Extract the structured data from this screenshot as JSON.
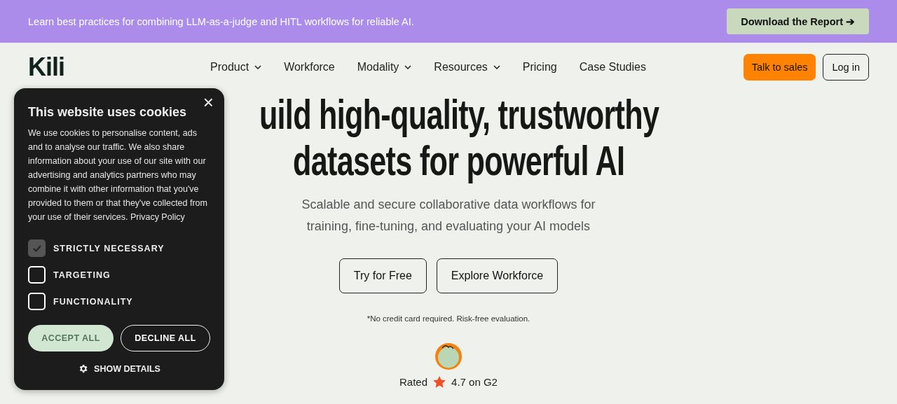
{
  "banner": {
    "text": "Learn best practices for combining LLM-as-a-judge and HITL workflows for reliable AI.",
    "button": "Download the Report ➔"
  },
  "header": {
    "logo": "Kili",
    "nav": [
      {
        "label": "Product",
        "dropdown": true
      },
      {
        "label": "Workforce",
        "dropdown": false
      },
      {
        "label": "Modality",
        "dropdown": true
      },
      {
        "label": "Resources",
        "dropdown": true
      },
      {
        "label": "Pricing",
        "dropdown": false
      },
      {
        "label": "Case Studies",
        "dropdown": false
      }
    ],
    "talk_button": "Talk to sales",
    "login_button": "Log in"
  },
  "hero": {
    "title_lines": [
      "uild high-quality, trustworthy",
      "datasets for powerful AI"
    ],
    "subtitle_lines": [
      "Scalable and secure collaborative data workflows for",
      "training, fine-tuning, and evaluating your AI models"
    ],
    "buttons": [
      "Try for Free",
      "Explore Workforce"
    ],
    "note": "*No credit card required. Risk-free evaluation.",
    "rating_prefix": "Rated",
    "rating_text": "4.7 on G2"
  },
  "cookie_dialog": {
    "close": "×",
    "title": "This website uses cookies",
    "body": "We use cookies to personalise content, ads and to analyse our traffic. We also share information about your use of our site with our advertising and analytics partners who may combine it with other information that you've provided to them or that they've collected from your use of their services.",
    "link": "Privacy Policy",
    "options": [
      {
        "label": "STRICTLY NECESSARY",
        "checked": true,
        "disabled": true
      },
      {
        "label": "TARGETING",
        "checked": false,
        "disabled": false
      },
      {
        "label": "FUNCTIONALITY",
        "checked": false,
        "disabled": false
      }
    ],
    "accept": "ACCEPT ALL",
    "decline": "DECLINE ALL",
    "details": "SHOW DETAILS"
  }
}
